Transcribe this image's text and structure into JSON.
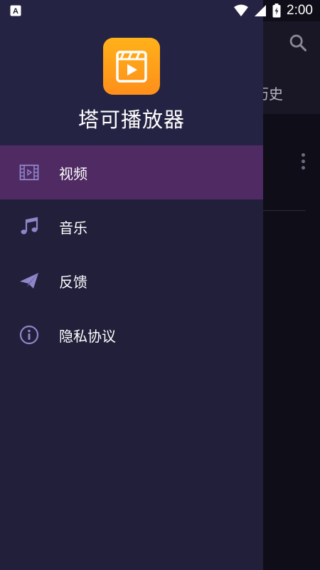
{
  "status_bar": {
    "time": "2:00",
    "left_icon": "accessibility-a-icon",
    "icons": [
      "wifi-icon",
      "cellular-signal-icon",
      "battery-charging-icon"
    ]
  },
  "background": {
    "tab_partial": "历史",
    "search_icon": "search-icon",
    "more_icon": "more-vertical-icon"
  },
  "drawer": {
    "app_name": "塔可播放器",
    "logo_icon": "video-clapper-play-icon",
    "items": [
      {
        "label": "视频",
        "icon": "film-icon",
        "active": true
      },
      {
        "label": "音乐",
        "icon": "music-note-icon",
        "active": false
      },
      {
        "label": "反馈",
        "icon": "paper-plane-icon",
        "active": false
      },
      {
        "label": "隐私协议",
        "icon": "info-icon",
        "active": false
      }
    ]
  },
  "colors": {
    "drawer_bg": "#211f3a",
    "active_item": "#4f2a63",
    "icon_tint": "#8f86c8",
    "logo_gradient": [
      "#ffb11a",
      "#ff8f1a"
    ]
  }
}
